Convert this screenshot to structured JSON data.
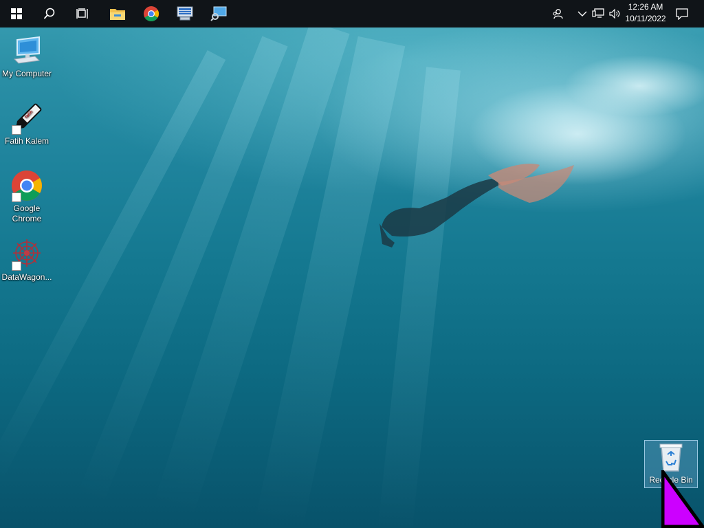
{
  "taskbar": {
    "start_icon": "windows-logo-icon",
    "search_icon": "search-icon",
    "task_view_icon": "task-view-icon",
    "pinned": [
      {
        "name": "file-explorer",
        "icon": "folder-icon"
      },
      {
        "name": "google-chrome",
        "icon": "chrome-icon"
      },
      {
        "name": "network-tool",
        "icon": "network-computer-icon"
      },
      {
        "name": "remote-desktop",
        "icon": "remote-search-icon"
      }
    ],
    "tray": {
      "people_icon": "people-icon",
      "overflow_icon": "chevron-up-icon",
      "network_icon": "network-icon",
      "volume_icon": "speaker-icon",
      "notification_icon": "notification-icon"
    },
    "clock": {
      "time": "12:26 AM",
      "date": "10/11/2022"
    }
  },
  "desktop": {
    "icons": [
      {
        "label": "My Computer",
        "icon": "computer-icon"
      },
      {
        "label": "Fatih Kalem",
        "icon": "pen-icon"
      },
      {
        "label": "Google Chrome",
        "icon": "chrome-icon"
      },
      {
        "label": "DataWagon...",
        "icon": "datawagon-icon"
      }
    ],
    "recycle_bin": {
      "label": "Recycle Bin",
      "icon": "recycle-bin-icon"
    }
  },
  "colors": {
    "taskbar": "#101418",
    "water_top": "#3a9fb3",
    "water_bottom": "#08526a",
    "cursor_fill": "#cc00ff"
  }
}
